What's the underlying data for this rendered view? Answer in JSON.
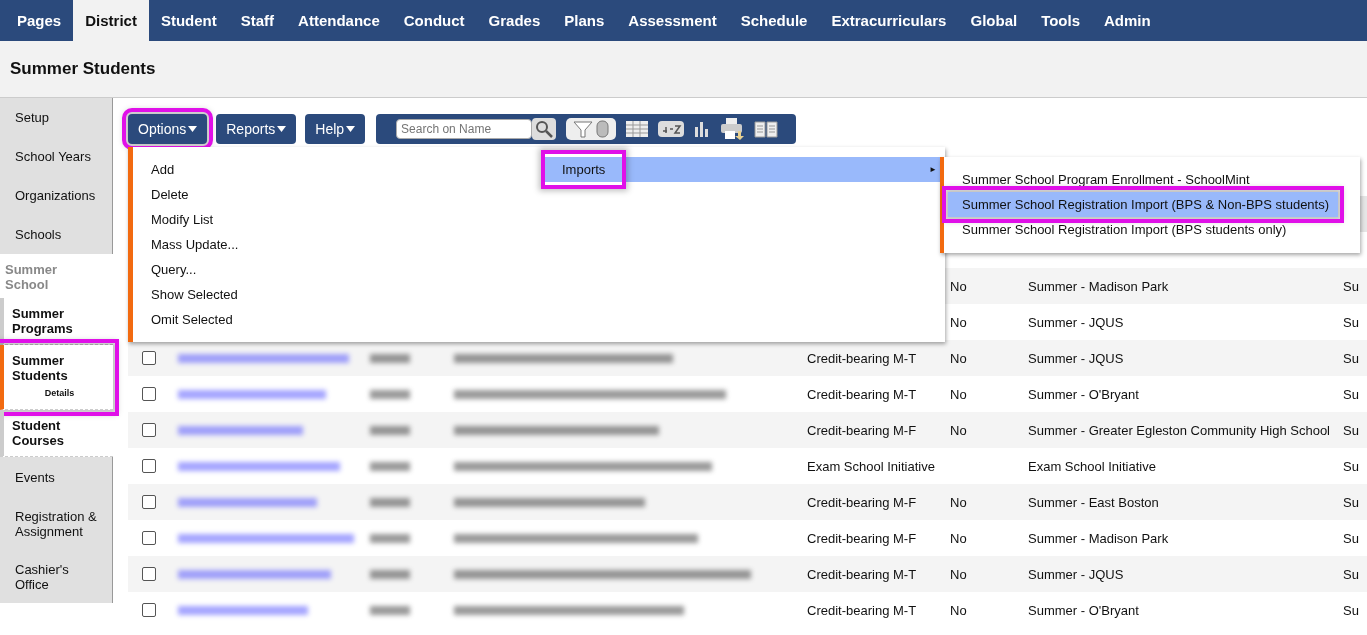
{
  "nav": {
    "tabs": [
      {
        "label": "Pages",
        "selected": false
      },
      {
        "label": "District",
        "selected": true
      },
      {
        "label": "Student",
        "selected": false
      },
      {
        "label": "Staff",
        "selected": false
      },
      {
        "label": "Attendance",
        "selected": false
      },
      {
        "label": "Conduct",
        "selected": false
      },
      {
        "label": "Grades",
        "selected": false
      },
      {
        "label": "Plans",
        "selected": false
      },
      {
        "label": "Assessment",
        "selected": false
      },
      {
        "label": "Schedule",
        "selected": false
      },
      {
        "label": "Extracurriculars",
        "selected": false
      },
      {
        "label": "Global",
        "selected": false
      },
      {
        "label": "Tools",
        "selected": false
      },
      {
        "label": "Admin",
        "selected": false
      }
    ]
  },
  "page_title": "Summer Students",
  "sidebar": {
    "items": [
      {
        "kind": "link",
        "label": "Setup"
      },
      {
        "kind": "link",
        "label": "School Years"
      },
      {
        "kind": "link",
        "label": "Organizations"
      },
      {
        "kind": "link",
        "label": "Schools"
      },
      {
        "kind": "section",
        "label": "Summer School",
        "children": [
          {
            "label": "Summer Programs",
            "selected": false,
            "highlighted": false
          },
          {
            "label": "Summer Students",
            "sublabel": "Details",
            "selected": true,
            "highlighted": true
          },
          {
            "label": "Student Courses",
            "selected": false,
            "highlighted": false
          }
        ]
      },
      {
        "kind": "link",
        "label": "Events"
      },
      {
        "kind": "link",
        "label": "Registration & Assignment"
      },
      {
        "kind": "link",
        "label": "Cashier's Office"
      }
    ]
  },
  "toolbar": {
    "buttons": [
      {
        "label": "Options",
        "highlighted": true
      },
      {
        "label": "Reports",
        "highlighted": false
      },
      {
        "label": "Help",
        "highlighted": false
      }
    ],
    "search": {
      "placeholder": "Search on Name"
    }
  },
  "options_menu": {
    "items": [
      "Add",
      "Delete",
      "Modify List",
      "Mass Update...",
      "Query...",
      "Show Selected",
      "Omit Selected"
    ],
    "imports": {
      "label": "Imports",
      "arrow": "►",
      "selected": true,
      "highlighted": true,
      "submenu": [
        {
          "label": "Summer School Program Enrollment - SchoolMint",
          "selected": false,
          "highlighted": false
        },
        {
          "label": "Summer School Registration Import (BPS & Non-BPS students)",
          "selected": true,
          "highlighted": true
        },
        {
          "label": "Summer School Registration Import (BPS students only)",
          "selected": false,
          "highlighted": false
        }
      ]
    }
  },
  "table": {
    "rows": [
      {
        "kind": "covered"
      },
      {
        "kind": "covered",
        "flag": "No",
        "program": "Summer - Madison Park",
        "column_8": "Su"
      },
      {
        "kind": "covered",
        "flag": "No",
        "program": "Summer - JQUS",
        "column_8": "Su"
      },
      {
        "kind": "full",
        "checked": false,
        "type": "Credit-bearing M-T",
        "flag": "No",
        "program": "Summer - JQUS",
        "column_8": "Su"
      },
      {
        "kind": "full",
        "checked": false,
        "type": "Credit-bearing M-T",
        "flag": "No",
        "program": "Summer - O'Bryant",
        "column_8": "Su"
      },
      {
        "kind": "full",
        "checked": false,
        "type": "Credit-bearing M-F",
        "flag": "No",
        "program": "Summer - Greater Egleston Community High School",
        "column_8": "Su"
      },
      {
        "kind": "full",
        "checked": false,
        "type": "Exam School Initiative",
        "program": "Exam School Initiative",
        "column_8": "Su"
      },
      {
        "kind": "full",
        "checked": false,
        "type": "Credit-bearing M-F",
        "flag": "No",
        "program": "Summer - East Boston",
        "column_8": "Su"
      },
      {
        "kind": "full",
        "checked": false,
        "type": "Credit-bearing M-F",
        "flag": "No",
        "program": "Summer - Madison Park",
        "column_8": "Su"
      },
      {
        "kind": "full",
        "checked": false,
        "type": "Credit-bearing M-T",
        "flag": "No",
        "program": "Summer - JQUS",
        "column_8": "Su"
      },
      {
        "kind": "full",
        "checked": false,
        "type": "Credit-bearing M-T",
        "flag": "No",
        "program": "Summer - O'Bryant",
        "column_8": "Su"
      }
    ]
  }
}
